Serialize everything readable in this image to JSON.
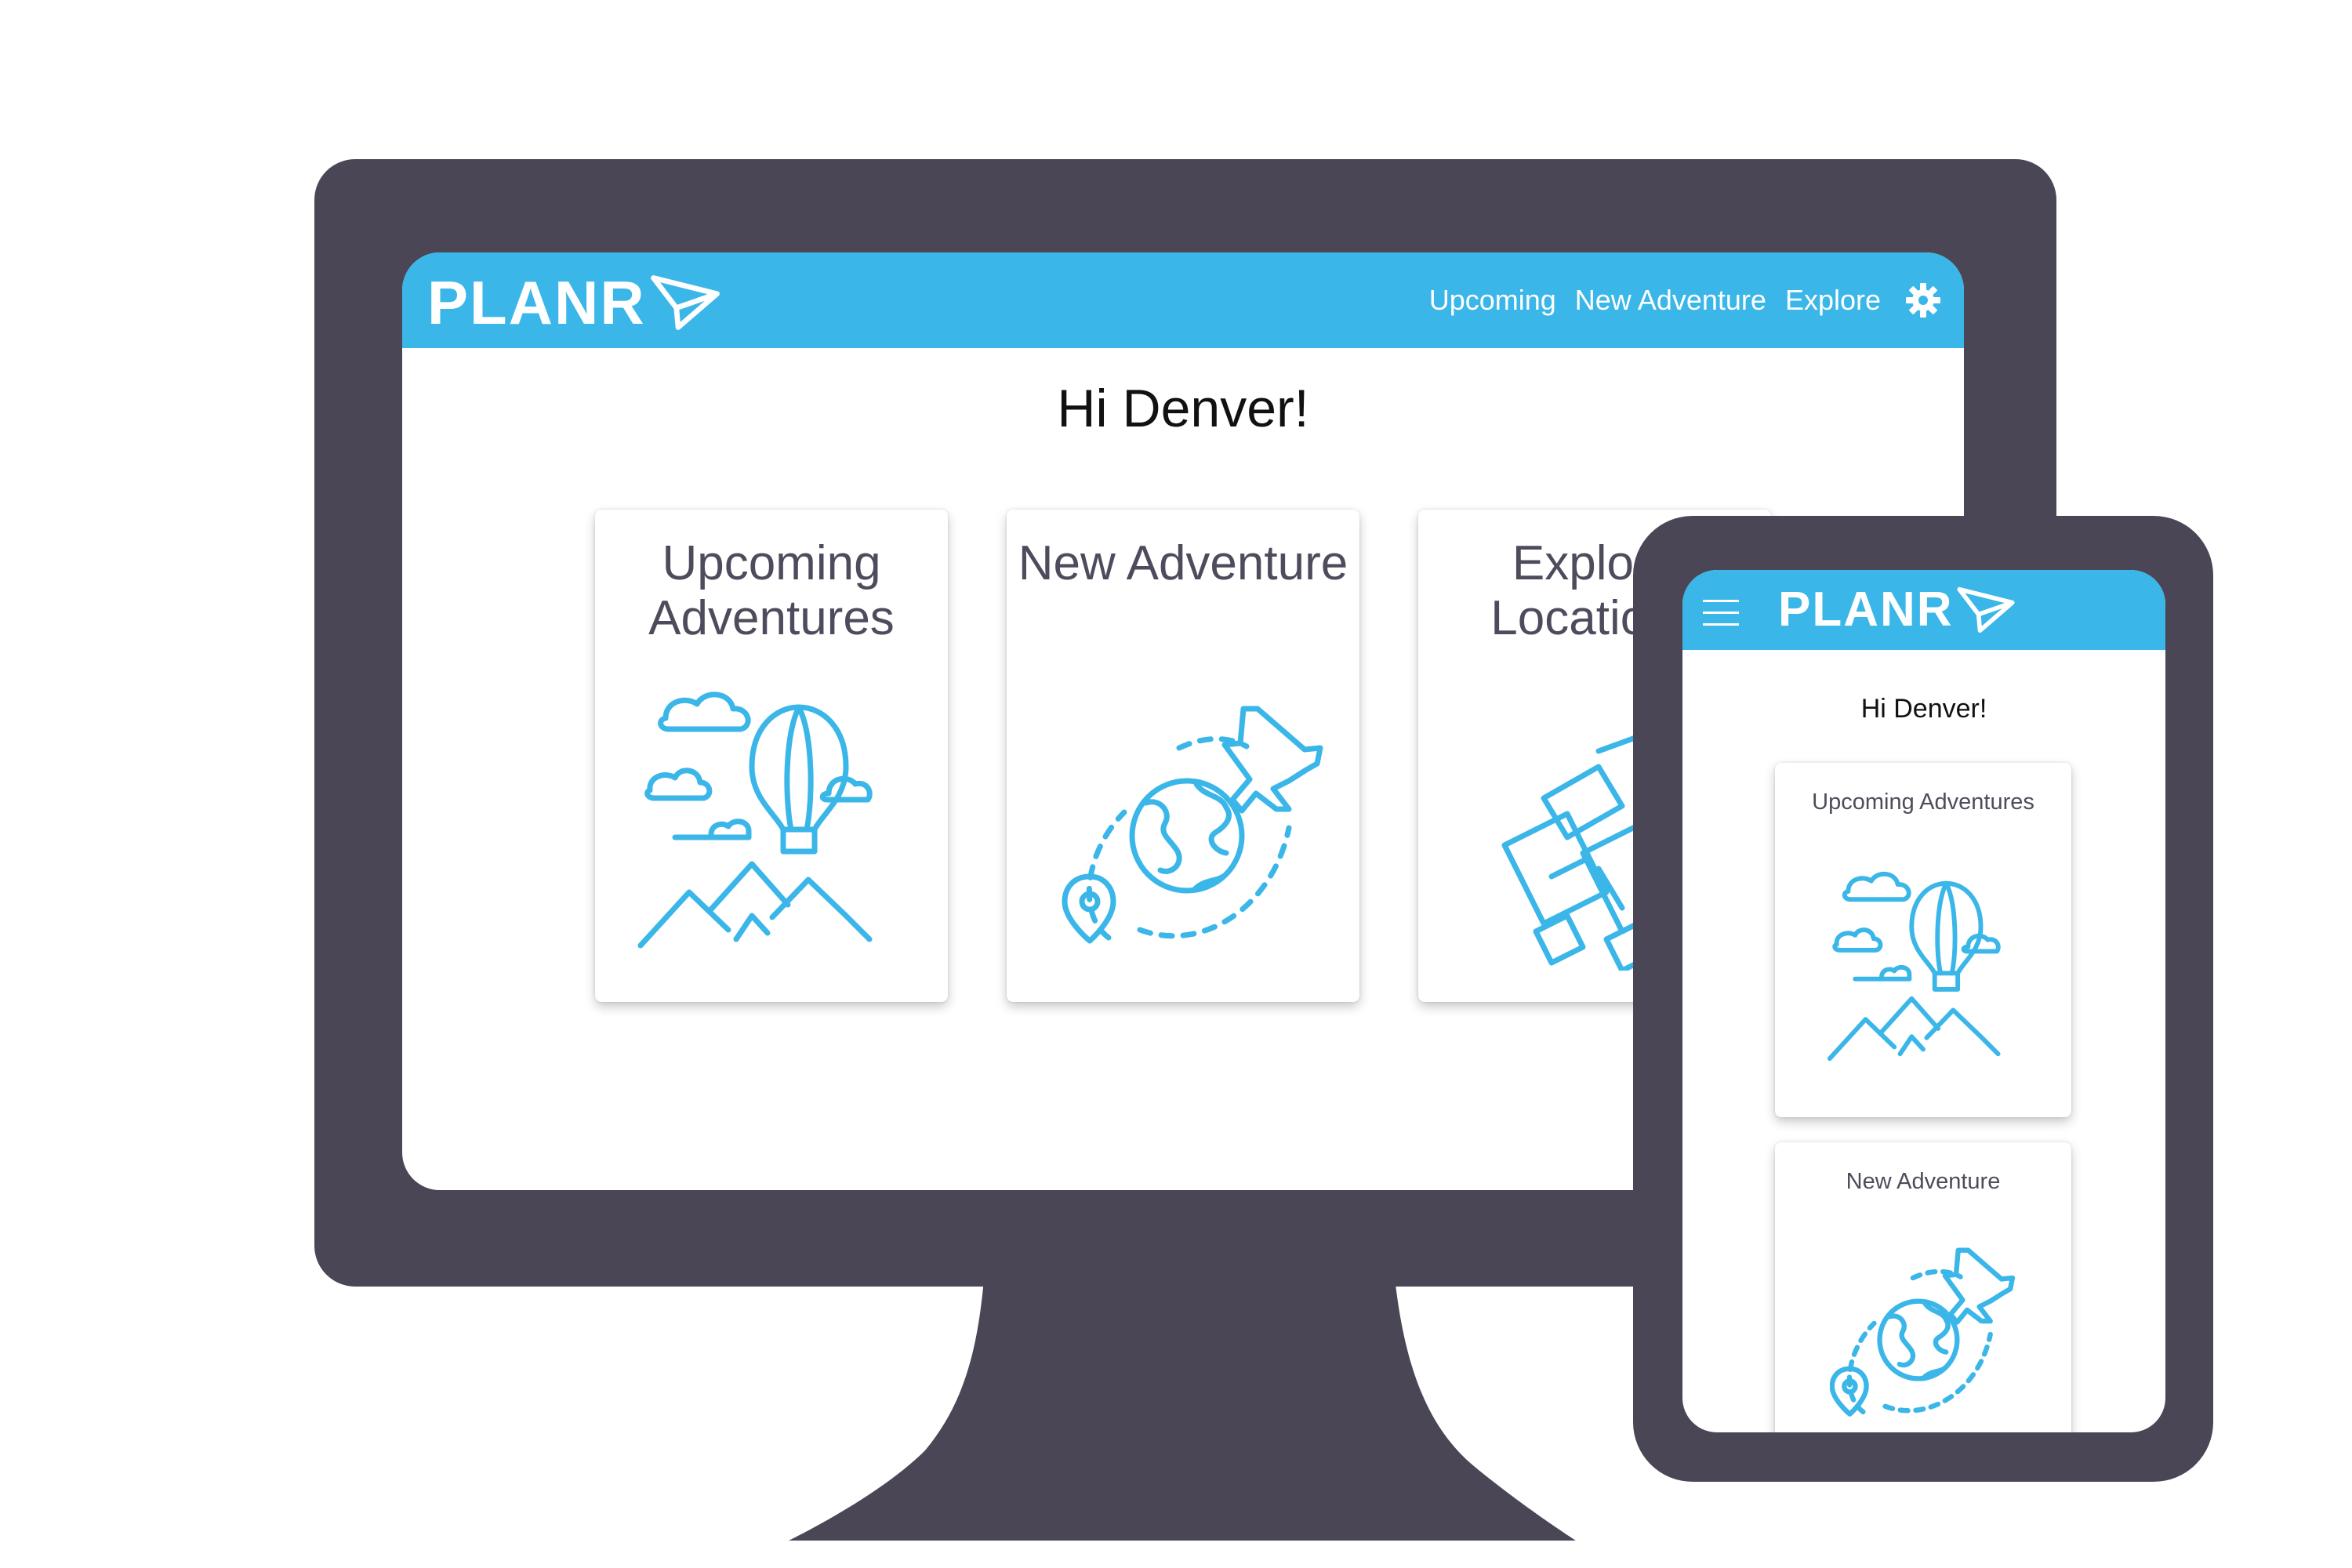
{
  "brand": {
    "logo_text": "PLANR",
    "accent_color": "#3BB6E8",
    "device_color": "#4A4656"
  },
  "desktop": {
    "nav": {
      "links": [
        "Upcoming",
        "New Adventure",
        "Explore"
      ],
      "settings_icon": "gear-icon"
    },
    "greeting": "Hi Denver!",
    "cards": [
      {
        "title": "Upcoming Adventures",
        "icon": "hot-air-balloon-icon"
      },
      {
        "title": "New Adventure",
        "icon": "globe-plane-icon"
      },
      {
        "title": "Explore Locations",
        "icon": "binoculars-map-icon"
      }
    ]
  },
  "mobile": {
    "nav": {
      "menu_icon": "hamburger-menu-icon"
    },
    "greeting": "Hi Denver!",
    "cards": [
      {
        "title": "Upcoming Adventures",
        "icon": "hot-air-balloon-icon"
      },
      {
        "title": "New Adventure",
        "icon": "globe-plane-icon"
      }
    ]
  }
}
